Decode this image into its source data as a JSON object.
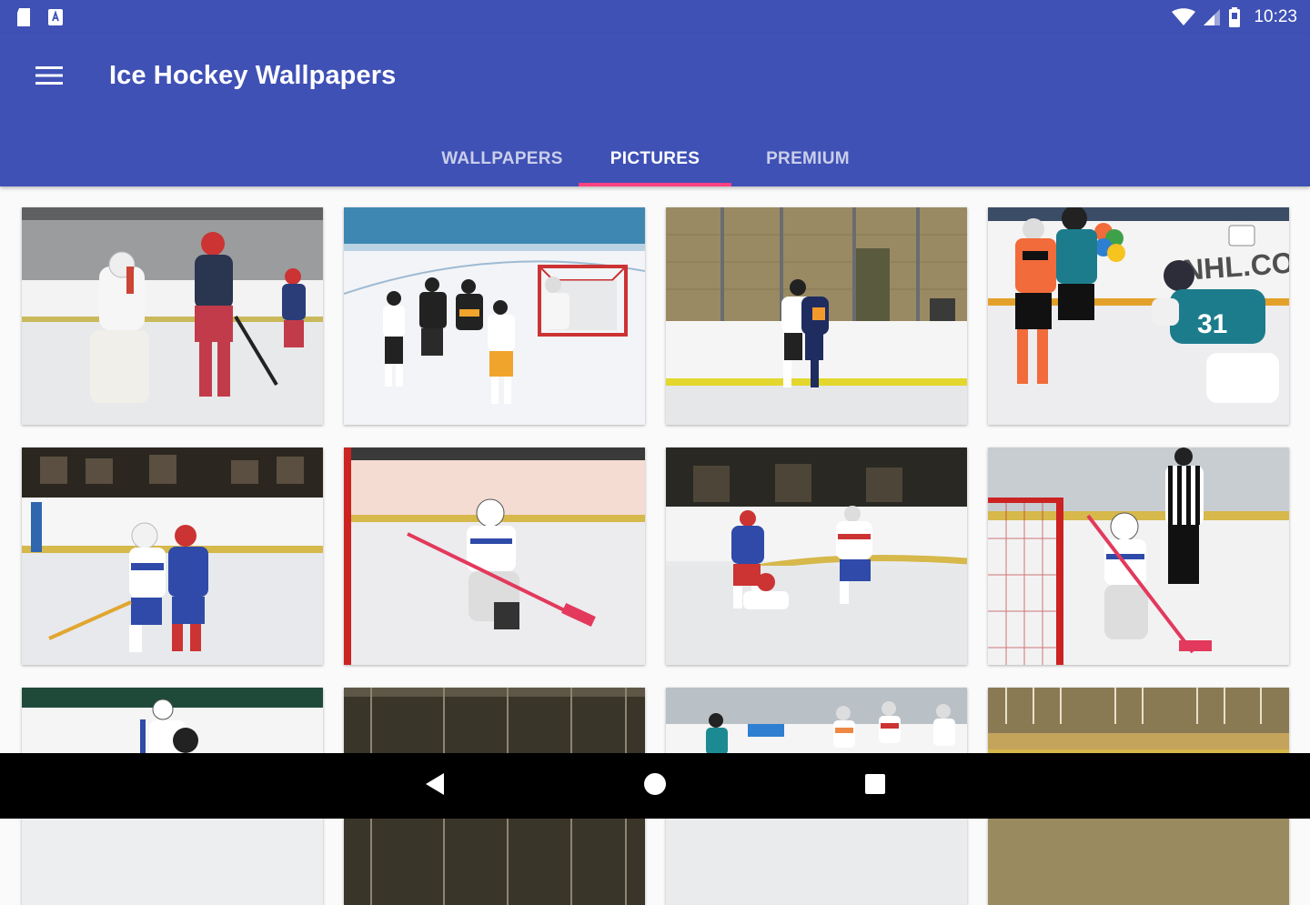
{
  "status_bar": {
    "time": "10:23",
    "icons": [
      "sd-card-icon",
      "app-notification-icon",
      "wifi-icon",
      "signal-icon",
      "battery-icon"
    ]
  },
  "app_bar": {
    "title": "Ice Hockey Wallpapers",
    "menu_icon": "menu-icon",
    "background": "#3f51b5"
  },
  "tabs": [
    {
      "label": "WALLPAPERS",
      "active": false
    },
    {
      "label": "PICTURES",
      "active": true
    },
    {
      "label": "PREMIUM",
      "active": false
    }
  ],
  "accent_color": "#ff4081",
  "grid": {
    "photo_count_visible": 12,
    "photos": [
      {
        "subject": "hockey goalie and player in red jersey in front of net",
        "overlay_text": ""
      },
      {
        "subject": "youth hockey players in front of goal on ice",
        "overlay_text": ""
      },
      {
        "subject": "players battling along the boards",
        "overlay_text": ""
      },
      {
        "subject": "goalie in teal jersey number 31 making a save",
        "overlay_text": "NHL.COM"
      },
      {
        "subject": "two players in blue and red jerseys colliding",
        "overlay_text": ""
      },
      {
        "subject": "goalie kneeling with pink-taped stick",
        "overlay_text": ""
      },
      {
        "subject": "players near the corner boards",
        "overlay_text": ""
      },
      {
        "subject": "goalie in front of net with referee behind",
        "overlay_text": ""
      },
      {
        "subject": "player skating near the boards",
        "overlay_text": ""
      },
      {
        "subject": "arena with dark stands",
        "overlay_text": ""
      },
      {
        "subject": "players lined up along the boards",
        "overlay_text": ""
      },
      {
        "subject": "arena stands and boards",
        "overlay_text": ""
      }
    ]
  },
  "nav_bar": {
    "buttons": [
      "back-icon",
      "home-icon",
      "recents-icon"
    ]
  }
}
